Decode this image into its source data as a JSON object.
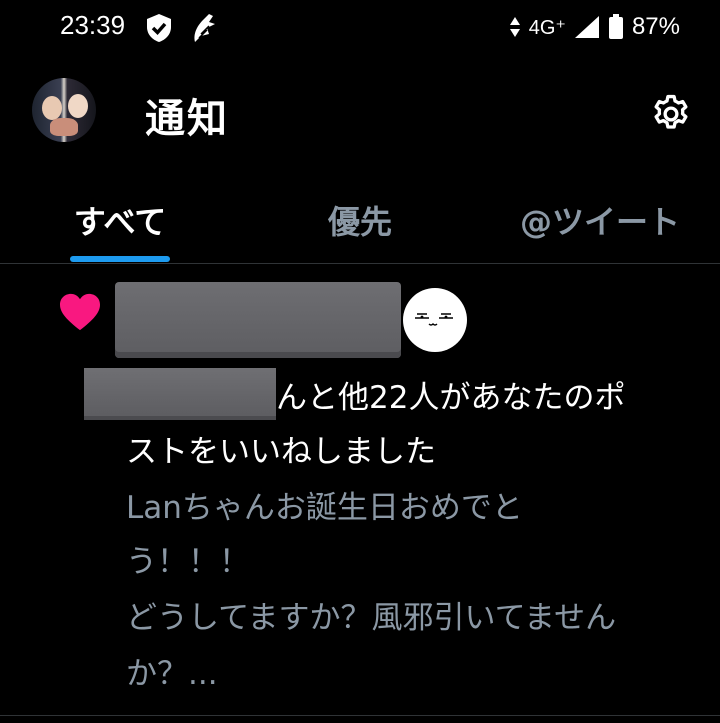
{
  "status_bar": {
    "time": "23:39",
    "network": "4G⁺",
    "battery": "87%",
    "icons": [
      "shield-check-icon",
      "bird-icon",
      "data-arrows-icon",
      "signal-icon",
      "battery-icon"
    ]
  },
  "header": {
    "title": "通知",
    "avatar_icon": "profile-avatar",
    "settings_icon": "gear-icon"
  },
  "tabs": [
    {
      "label": "すべて",
      "active": true
    },
    {
      "label": "優先",
      "active": false
    },
    {
      "label": "@ツイート",
      "active": false
    }
  ],
  "notification": {
    "icon": "heart-icon",
    "icon_color": "#f91880",
    "line1": "んと他22人があなたのポ",
    "line2": "ストをいいねしました",
    "preview_lines": [
      "Lanちゃんお誕生日おめでと",
      "う！！！",
      "どうしてますか？風邪引いてません",
      "か？..."
    ]
  },
  "colors": {
    "background": "#000000",
    "accent": "#1d9bf0",
    "muted_text": "#8b98a5",
    "like": "#f91880"
  }
}
